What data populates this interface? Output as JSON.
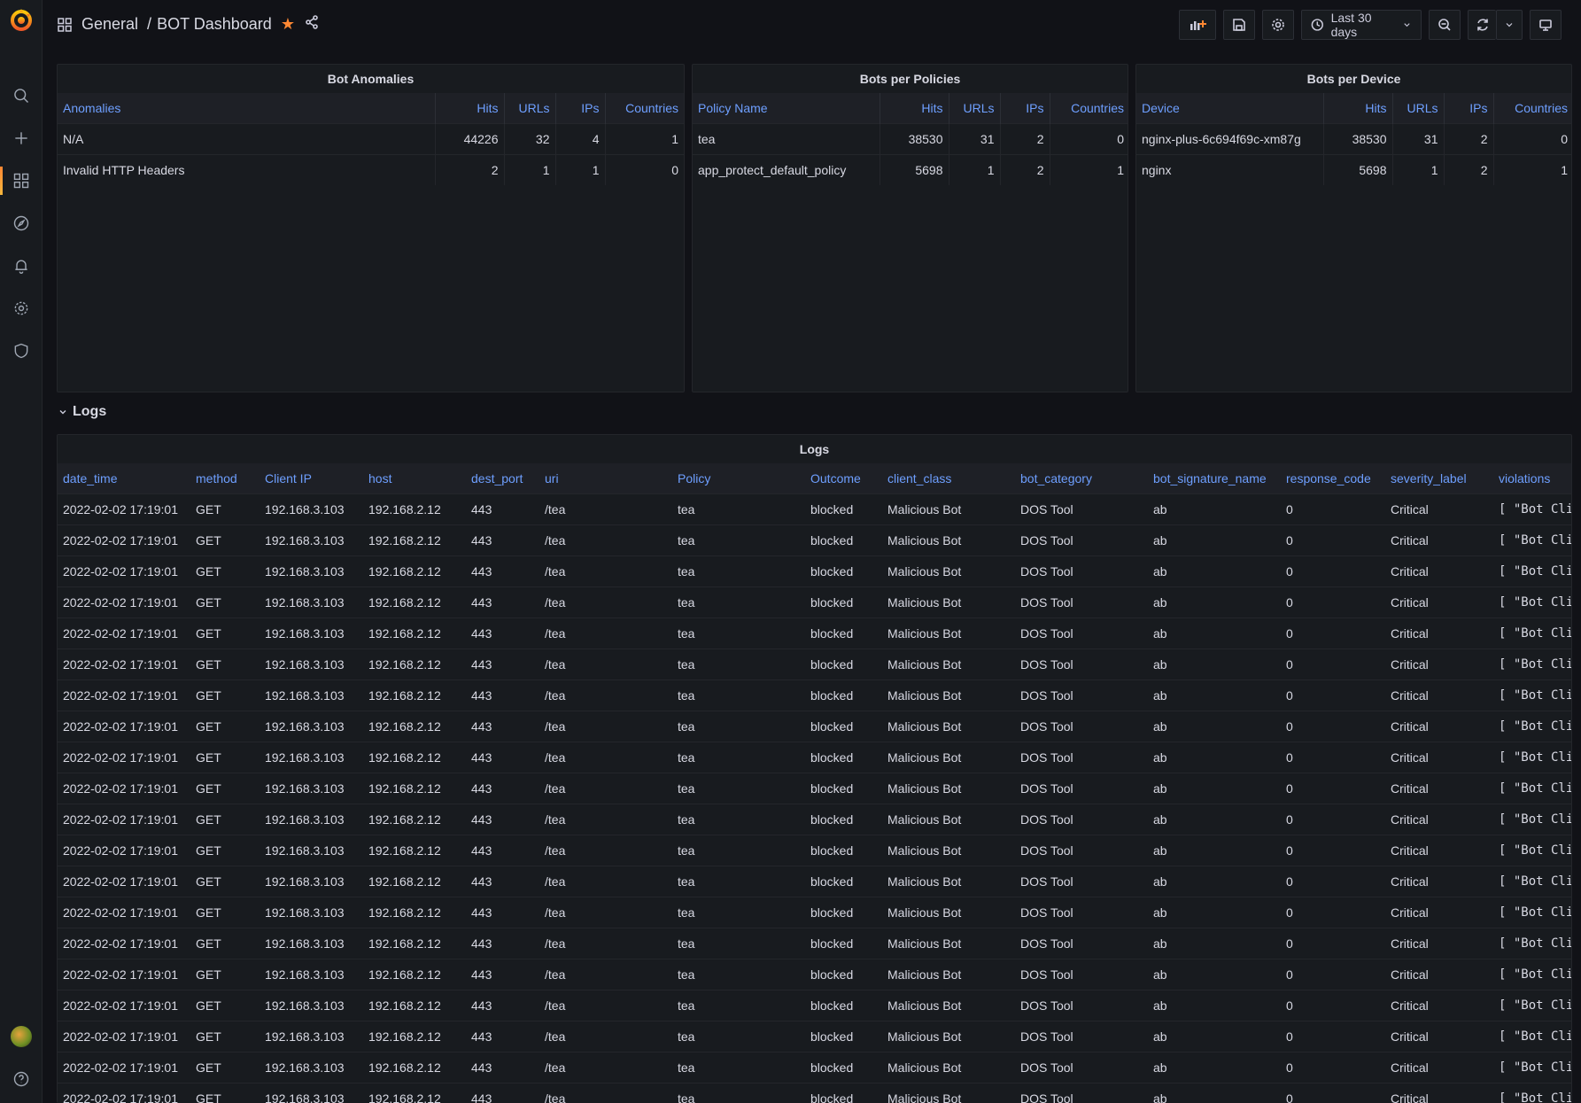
{
  "breadcrumb": {
    "folder": "General",
    "separator": "/",
    "dashboard": "BOT Dashboard"
  },
  "toolbar": {
    "time_range": "Last 30 days"
  },
  "panels": {
    "anomalies": {
      "title": "Bot Anomalies",
      "columns": [
        "Anomalies",
        "Hits",
        "URLs",
        "IPs",
        "Countries"
      ],
      "rows": [
        [
          "N/A",
          "44226",
          "32",
          "4",
          "1"
        ],
        [
          "Invalid HTTP Headers",
          "2",
          "1",
          "1",
          "0"
        ]
      ]
    },
    "policies": {
      "title": "Bots per Policies",
      "columns": [
        "Policy Name",
        "Hits",
        "URLs",
        "IPs",
        "Countries"
      ],
      "rows": [
        [
          "tea",
          "38530",
          "31",
          "2",
          "0"
        ],
        [
          "app_protect_default_policy",
          "5698",
          "1",
          "2",
          "1"
        ]
      ]
    },
    "devices": {
      "title": "Bots per Device",
      "columns": [
        "Device",
        "Hits",
        "URLs",
        "IPs",
        "Countries"
      ],
      "rows": [
        [
          "nginx-plus-6c694f69c-xm87g",
          "38530",
          "31",
          "2",
          "0"
        ],
        [
          "nginx",
          "5698",
          "1",
          "2",
          "1"
        ]
      ]
    }
  },
  "logs_row": {
    "title": "Logs"
  },
  "logs": {
    "title": "Logs",
    "columns": [
      "date_time",
      "method",
      "Client IP",
      "host",
      "dest_port",
      "uri",
      "Policy",
      "Outcome",
      "client_class",
      "bot_category",
      "bot_signature_name",
      "response_code",
      "severity_label",
      "violations"
    ],
    "row_template": [
      "2022-02-02 17:19:01",
      "GET",
      "192.168.3.103",
      "192.168.2.12",
      "443",
      "/tea",
      "tea",
      "blocked",
      "Malicious Bot",
      "DOS Tool",
      "ab",
      "0",
      "Critical",
      "[ \"Bot Cli"
    ],
    "row_count": 20
  }
}
